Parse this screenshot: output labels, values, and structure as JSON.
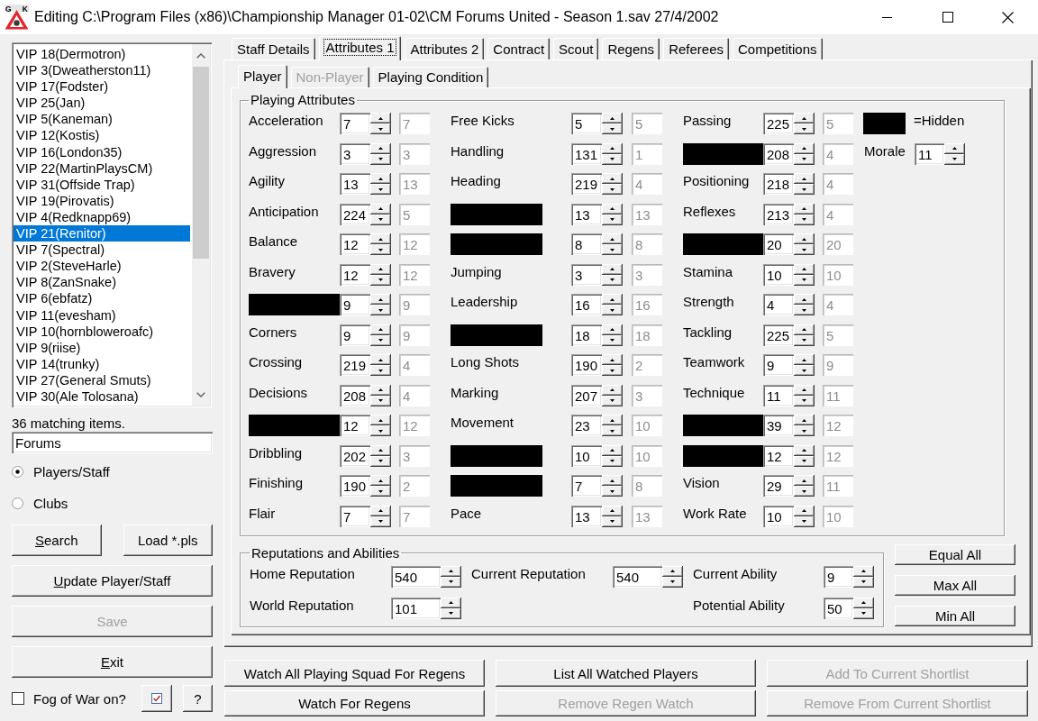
{
  "window": {
    "title": "Editing C:\\Program Files (x86)\\Championship Manager 01-02\\CM Forums United - Season 1.sav 27/4/2002",
    "logo_letters": [
      "G",
      "K"
    ]
  },
  "player_list": {
    "items": [
      {
        "label": "VIP 18(Dermotron)",
        "selected": false
      },
      {
        "label": "VIP 3(Dweatherston11)",
        "selected": false
      },
      {
        "label": "VIP 17(Fodster)",
        "selected": false
      },
      {
        "label": "VIP 25(Jan)",
        "selected": false
      },
      {
        "label": "VIP 5(Kaneman)",
        "selected": false
      },
      {
        "label": "VIP 12(Kostis)",
        "selected": false
      },
      {
        "label": "VIP 16(London35)",
        "selected": false
      },
      {
        "label": "VIP 22(MartinPlaysCM)",
        "selected": false
      },
      {
        "label": "VIP 31(Offside Trap)",
        "selected": false
      },
      {
        "label": "VIP 19(Pirovatis)",
        "selected": false
      },
      {
        "label": "VIP 4(Redknapp69)",
        "selected": false
      },
      {
        "label": "VIP 21(Renitor)",
        "selected": true
      },
      {
        "label": "VIP 7(Spectral)",
        "selected": false
      },
      {
        "label": "VIP 2(SteveHarle)",
        "selected": false
      },
      {
        "label": "VIP 8(ZanSnake)",
        "selected": false
      },
      {
        "label": "VIP 6(ebfatz)",
        "selected": false
      },
      {
        "label": "VIP 11(evesham)",
        "selected": false
      },
      {
        "label": "VIP 10(hornbloweroafc)",
        "selected": false
      },
      {
        "label": "VIP 9(riise)",
        "selected": false
      },
      {
        "label": "VIP 14(trunky)",
        "selected": false
      },
      {
        "label": "VIP 27(General Smuts)",
        "selected": false
      },
      {
        "label": "VIP 30(Ale Tolosana)",
        "selected": false
      }
    ]
  },
  "match_count": "36 matching items.",
  "search_field": {
    "value": "Forums"
  },
  "search_scope": [
    {
      "label": "Players/Staff",
      "selected": true
    },
    {
      "label": "Clubs",
      "selected": false
    }
  ],
  "side_buttons": [
    [
      {
        "label": "Search",
        "mnemonic": true,
        "disabled": false
      },
      {
        "label": "Load *.pls",
        "mnemonic": false,
        "disabled": false
      }
    ],
    [
      {
        "label": "Update Player/Staff",
        "mnemonic": true,
        "disabled": false
      }
    ],
    [
      {
        "label": "Save",
        "mnemonic": false,
        "disabled": true
      }
    ],
    [
      {
        "label": "Exit",
        "mnemonic": true,
        "disabled": false
      }
    ]
  ],
  "fog_of_war": {
    "label": "Fog of War on?",
    "checked": false
  },
  "tool_buttons": [
    {
      "kind": "icon"
    },
    {
      "kind": "text",
      "label": "?"
    }
  ],
  "tabs": [
    {
      "label": "Staff Details",
      "selected": false
    },
    {
      "label": "Attributes 1",
      "selected": true
    },
    {
      "label": "Attributes 2",
      "selected": false
    },
    {
      "label": "Contract",
      "selected": false
    },
    {
      "label": "Scout",
      "selected": false
    },
    {
      "label": "Regens",
      "selected": false
    },
    {
      "label": "Referees",
      "selected": false
    },
    {
      "label": "Competitions",
      "selected": false
    }
  ],
  "sub_tabs": [
    {
      "label": "Player",
      "selected": true,
      "disabled": false
    },
    {
      "label": "Non-Player",
      "selected": false,
      "disabled": true
    },
    {
      "label": "Playing Condition",
      "selected": false,
      "disabled": false
    }
  ],
  "playing_attributes": {
    "title": "Playing Attributes",
    "columns": [
      [
        {
          "label": "Acceleration",
          "hidden": false,
          "value": "7",
          "readonly_value": "7"
        },
        {
          "label": "Aggression",
          "hidden": false,
          "value": "3",
          "readonly_value": "3"
        },
        {
          "label": "Agility",
          "hidden": false,
          "value": "13",
          "readonly_value": "13"
        },
        {
          "label": "Anticipation",
          "hidden": false,
          "value": "224",
          "readonly_value": "5"
        },
        {
          "label": "Balance",
          "hidden": false,
          "value": "12",
          "readonly_value": "12"
        },
        {
          "label": "Bravery",
          "hidden": false,
          "value": "12",
          "readonly_value": "12"
        },
        {
          "hidden": true,
          "value": "9",
          "readonly_value": "9"
        },
        {
          "label": "Corners",
          "hidden": false,
          "value": "9",
          "readonly_value": "9"
        },
        {
          "label": "Crossing",
          "hidden": false,
          "value": "219",
          "readonly_value": "4"
        },
        {
          "label": "Decisions",
          "hidden": false,
          "value": "208",
          "readonly_value": "4"
        },
        {
          "hidden": true,
          "value": "12",
          "readonly_value": "12"
        },
        {
          "label": "Dribbling",
          "hidden": false,
          "value": "202",
          "readonly_value": "3"
        },
        {
          "label": "Finishing",
          "hidden": false,
          "value": "190",
          "readonly_value": "2"
        },
        {
          "label": "Flair",
          "hidden": false,
          "value": "7",
          "readonly_value": "7"
        }
      ],
      [
        {
          "label": "Free Kicks",
          "hidden": false,
          "value": "5",
          "readonly_value": "5"
        },
        {
          "label": "Handling",
          "hidden": false,
          "value": "131",
          "readonly_value": "1"
        },
        {
          "label": "Heading",
          "hidden": false,
          "value": "219",
          "readonly_value": "4"
        },
        {
          "hidden": true,
          "value": "13",
          "readonly_value": "13"
        },
        {
          "hidden": true,
          "value": "8",
          "readonly_value": "8"
        },
        {
          "label": "Jumping",
          "hidden": false,
          "value": "3",
          "readonly_value": "3"
        },
        {
          "label": "Leadership",
          "hidden": false,
          "value": "16",
          "readonly_value": "16"
        },
        {
          "hidden": true,
          "value": "18",
          "readonly_value": "18"
        },
        {
          "label": "Long Shots",
          "hidden": false,
          "value": "190",
          "readonly_value": "2"
        },
        {
          "label": "Marking",
          "hidden": false,
          "value": "207",
          "readonly_value": "3"
        },
        {
          "label": "Movement",
          "hidden": false,
          "value": "23",
          "readonly_value": "10"
        },
        {
          "hidden": true,
          "value": "10",
          "readonly_value": "10"
        },
        {
          "hidden": true,
          "value": "7",
          "readonly_value": "8"
        },
        {
          "label": "Pace",
          "hidden": false,
          "value": "13",
          "readonly_value": "13"
        }
      ],
      [
        {
          "label": "Passing",
          "hidden": false,
          "value": "225",
          "readonly_value": "5"
        },
        {
          "hidden": true,
          "value": "208",
          "readonly_value": "4"
        },
        {
          "label": "Positioning",
          "hidden": false,
          "value": "218",
          "readonly_value": "4"
        },
        {
          "label": "Reflexes",
          "hidden": false,
          "value": "213",
          "readonly_value": "4"
        },
        {
          "hidden": true,
          "value": "20",
          "readonly_value": "20"
        },
        {
          "label": "Stamina",
          "hidden": false,
          "value": "10",
          "readonly_value": "10"
        },
        {
          "label": "Strength",
          "hidden": false,
          "value": "4",
          "readonly_value": "4"
        },
        {
          "label": "Tackling",
          "hidden": false,
          "value": "225",
          "readonly_value": "5"
        },
        {
          "label": "Teamwork",
          "hidden": false,
          "value": "9",
          "readonly_value": "9"
        },
        {
          "label": "Technique",
          "hidden": false,
          "value": "11",
          "readonly_value": "11"
        },
        {
          "hidden": true,
          "value": "39",
          "readonly_value": "12"
        },
        {
          "hidden": true,
          "value": "12",
          "readonly_value": "12"
        },
        {
          "label": "Vision",
          "hidden": false,
          "value": "29",
          "readonly_value": "11"
        },
        {
          "label": "Work Rate",
          "hidden": false,
          "value": "10",
          "readonly_value": "10"
        }
      ]
    ]
  },
  "hidden_legend": {
    "label": "=Hidden"
  },
  "morale": {
    "label": "Morale",
    "value": "11"
  },
  "reputations": {
    "title": "Reputations and Abilities",
    "columns": [
      [
        {
          "label": "Home Reputation",
          "value": "540"
        },
        {
          "label": "World Reputation",
          "value": "101"
        }
      ],
      [
        {
          "label": "Current Reputation",
          "value": "540"
        }
      ],
      [
        {
          "label": "Current Ability",
          "value": "9"
        },
        {
          "label": "Potential Ability",
          "value": "50"
        }
      ]
    ]
  },
  "set_buttons": [
    {
      "label": "Equal All"
    },
    {
      "label": "Max All"
    },
    {
      "label": "Min All"
    }
  ],
  "action_buttons": [
    {
      "label": "Watch All Playing Squad For Regens",
      "disabled": false
    },
    {
      "label": "List All Watched Players",
      "disabled": false
    },
    {
      "label": "Add To Current Shortlist",
      "disabled": true
    },
    {
      "label": "Watch For Regens",
      "disabled": false
    },
    {
      "label": "Remove Regen Watch",
      "disabled": true
    },
    {
      "label": "Remove From Current Shortlist",
      "disabled": true
    }
  ]
}
